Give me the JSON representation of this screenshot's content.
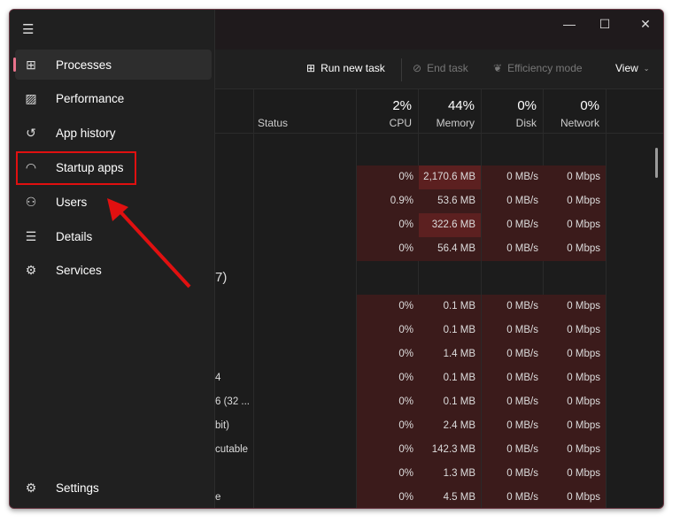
{
  "window": {
    "minimize_icon": "—",
    "maximize_icon": "☐",
    "close_icon": "✕"
  },
  "toolbar": {
    "run_new_task": "Run new task",
    "end_task": "End task",
    "efficiency_mode": "Efficiency mode",
    "view": "View"
  },
  "header": {
    "status": "Status",
    "cpu_pct": "2%",
    "cpu": "CPU",
    "memory_pct": "44%",
    "memory": "Memory",
    "disk_pct": "0%",
    "disk": "Disk",
    "network_pct": "0%",
    "network": "Network"
  },
  "group2_count_fragment": "7)",
  "rows_group1": [
    {
      "name": "",
      "cpu": "0%",
      "memory": "2,170.6 MB",
      "disk": "0 MB/s",
      "network": "0 Mbps",
      "hot": true
    },
    {
      "name": "",
      "cpu": "0.9%",
      "memory": "53.6 MB",
      "disk": "0 MB/s",
      "network": "0 Mbps",
      "hot": false
    },
    {
      "name": "",
      "cpu": "0%",
      "memory": "322.6 MB",
      "disk": "0 MB/s",
      "network": "0 Mbps",
      "hot": true
    },
    {
      "name": "",
      "cpu": "0%",
      "memory": "56.4 MB",
      "disk": "0 MB/s",
      "network": "0 Mbps",
      "hot": false
    }
  ],
  "rows_group2": [
    {
      "name": "",
      "cpu": "0%",
      "memory": "0.1 MB",
      "disk": "0 MB/s",
      "network": "0 Mbps"
    },
    {
      "name": "",
      "cpu": "0%",
      "memory": "0.1 MB",
      "disk": "0 MB/s",
      "network": "0 Mbps"
    },
    {
      "name": "",
      "cpu": "0%",
      "memory": "1.4 MB",
      "disk": "0 MB/s",
      "network": "0 Mbps"
    },
    {
      "name": "4",
      "cpu": "0%",
      "memory": "0.1 MB",
      "disk": "0 MB/s",
      "network": "0 Mbps"
    },
    {
      "name": "6 (32 ...",
      "cpu": "0%",
      "memory": "0.1 MB",
      "disk": "0 MB/s",
      "network": "0 Mbps"
    },
    {
      "name": "bit)",
      "cpu": "0%",
      "memory": "2.4 MB",
      "disk": "0 MB/s",
      "network": "0 Mbps"
    },
    {
      "name": "cutable",
      "cpu": "0%",
      "memory": "142.3 MB",
      "disk": "0 MB/s",
      "network": "0 Mbps"
    },
    {
      "name": "",
      "cpu": "0%",
      "memory": "1.3 MB",
      "disk": "0 MB/s",
      "network": "0 Mbps"
    },
    {
      "name": "e",
      "cpu": "0%",
      "memory": "4.5 MB",
      "disk": "0 MB/s",
      "network": "0 Mbps"
    }
  ],
  "sidebar": {
    "items": [
      {
        "label": "Processes",
        "icon": "processes-icon",
        "glyph": "⊞"
      },
      {
        "label": "Performance",
        "icon": "performance-icon",
        "glyph": "▨"
      },
      {
        "label": "App history",
        "icon": "history-icon",
        "glyph": "↺"
      },
      {
        "label": "Startup apps",
        "icon": "startup-icon",
        "glyph": "◠"
      },
      {
        "label": "Users",
        "icon": "users-icon",
        "glyph": "⚇"
      },
      {
        "label": "Details",
        "icon": "details-icon",
        "glyph": "☰"
      },
      {
        "label": "Services",
        "icon": "services-icon",
        "glyph": "⚙"
      }
    ],
    "settings": "Settings",
    "settings_glyph": "⚙",
    "menu_glyph": "☰"
  },
  "colors": {
    "accent": "#e8738c",
    "highlight": "#e01010",
    "heat": "#3b1b1b",
    "heat_strong": "#5c2020"
  }
}
